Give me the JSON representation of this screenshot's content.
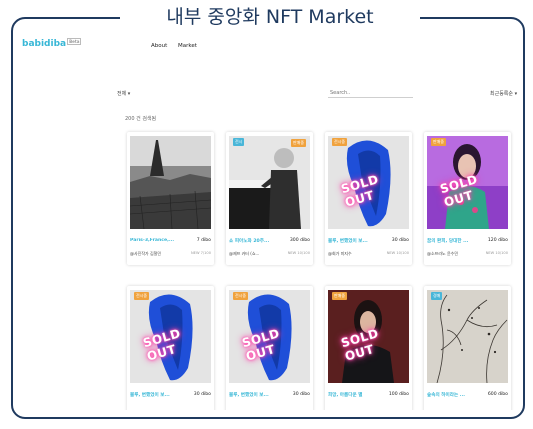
{
  "caption": "내부 중앙화 NFT Market",
  "header": {
    "logo": "babidiba",
    "logo_badge": "Beta",
    "nav": [
      "About",
      "Market"
    ]
  },
  "filters": {
    "category": "전체 ▾",
    "search_placeholder": "Search..",
    "sort": "최근등록순 ▾",
    "count": "200 건 검색됨"
  },
  "items": [
    {
      "title": "Paris-3,France,...",
      "price": "7 dibo",
      "artist": "@사진작가 김철민",
      "edition": "NEW 7/100",
      "badge": "",
      "badge_right": "",
      "sold_out": false,
      "image": "paris"
    },
    {
      "title": "쇼 피아노와 20주...",
      "price": "300 dibo",
      "artist": "@제프 카터 (쇼...",
      "edition": "NEW 10/100",
      "badge": "전시",
      "badge_right": "판매중",
      "sold_out": false,
      "image": "piano"
    },
    {
      "title": "블루, 변했었이 보...",
      "price": "30 dibo",
      "artist": "@회가 미지수",
      "edition": "NEW 10/100",
      "badge": "전시중",
      "badge_right": "",
      "sold_out": true,
      "image": "blue"
    },
    {
      "title": "꿈의 환희, 당대한 ...",
      "price": "120 dibo",
      "artist": "@소프라노 윤수민",
      "edition": "NEW 10/100",
      "badge": "판매중",
      "badge_right": "",
      "sold_out": true,
      "image": "singer"
    },
    {
      "title": "블루, 변했었이 보...",
      "price": "30 dibo",
      "artist": "",
      "edition": "",
      "badge": "전시중",
      "badge_right": "",
      "sold_out": true,
      "image": "blue"
    },
    {
      "title": "블루, 변했었이 보...",
      "price": "30 dibo",
      "artist": "",
      "edition": "",
      "badge": "전시중",
      "badge_right": "",
      "sold_out": true,
      "image": "blue"
    },
    {
      "title": "희망, 아름다운 별",
      "price": "100 dibo",
      "artist": "",
      "edition": "",
      "badge": "판매중",
      "badge_right": "",
      "sold_out": true,
      "image": "woman"
    },
    {
      "title": "숲속의 하이라는 ...",
      "price": "600 dibo",
      "artist": "",
      "edition": "",
      "badge": "경매",
      "badge_right": "",
      "sold_out": false,
      "image": "forest"
    }
  ],
  "sold_out_text": "SOLD OUT",
  "colors": {
    "accent": "#38b7d6",
    "frame": "#1f3a5f",
    "sold_glow": "#ff3fa8",
    "badge": "#f0a23d"
  }
}
